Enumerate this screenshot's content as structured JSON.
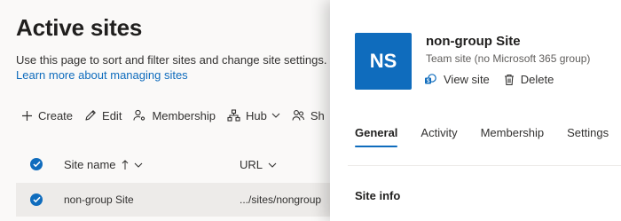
{
  "page": {
    "title": "Active sites",
    "description": "Use this page to sort and filter sites and change site settings.",
    "learn_more_link": "Learn more about managing sites"
  },
  "command_bar": {
    "create": "Create",
    "edit": "Edit",
    "membership": "Membership",
    "hub": "Hub",
    "sharing_partial": "Sh"
  },
  "table": {
    "columns": {
      "site_name": "Site name",
      "url": "URL"
    },
    "rows": [
      {
        "name": "non-group Site",
        "url": ".../sites/nongroup",
        "selected": true
      }
    ]
  },
  "panel": {
    "avatar_initials": "NS",
    "site_title": "non-group Site",
    "site_type": "Team site (no Microsoft 365 group)",
    "actions": {
      "view_site": "View site",
      "delete": "Delete"
    },
    "tabs": [
      "General",
      "Activity",
      "Membership",
      "Settings"
    ],
    "active_tab": "General",
    "section_title": "Site info"
  },
  "colors": {
    "accent": "#0f6cbd",
    "selected_row_bg": "#edebe9",
    "page_bg": "#faf9f8"
  }
}
